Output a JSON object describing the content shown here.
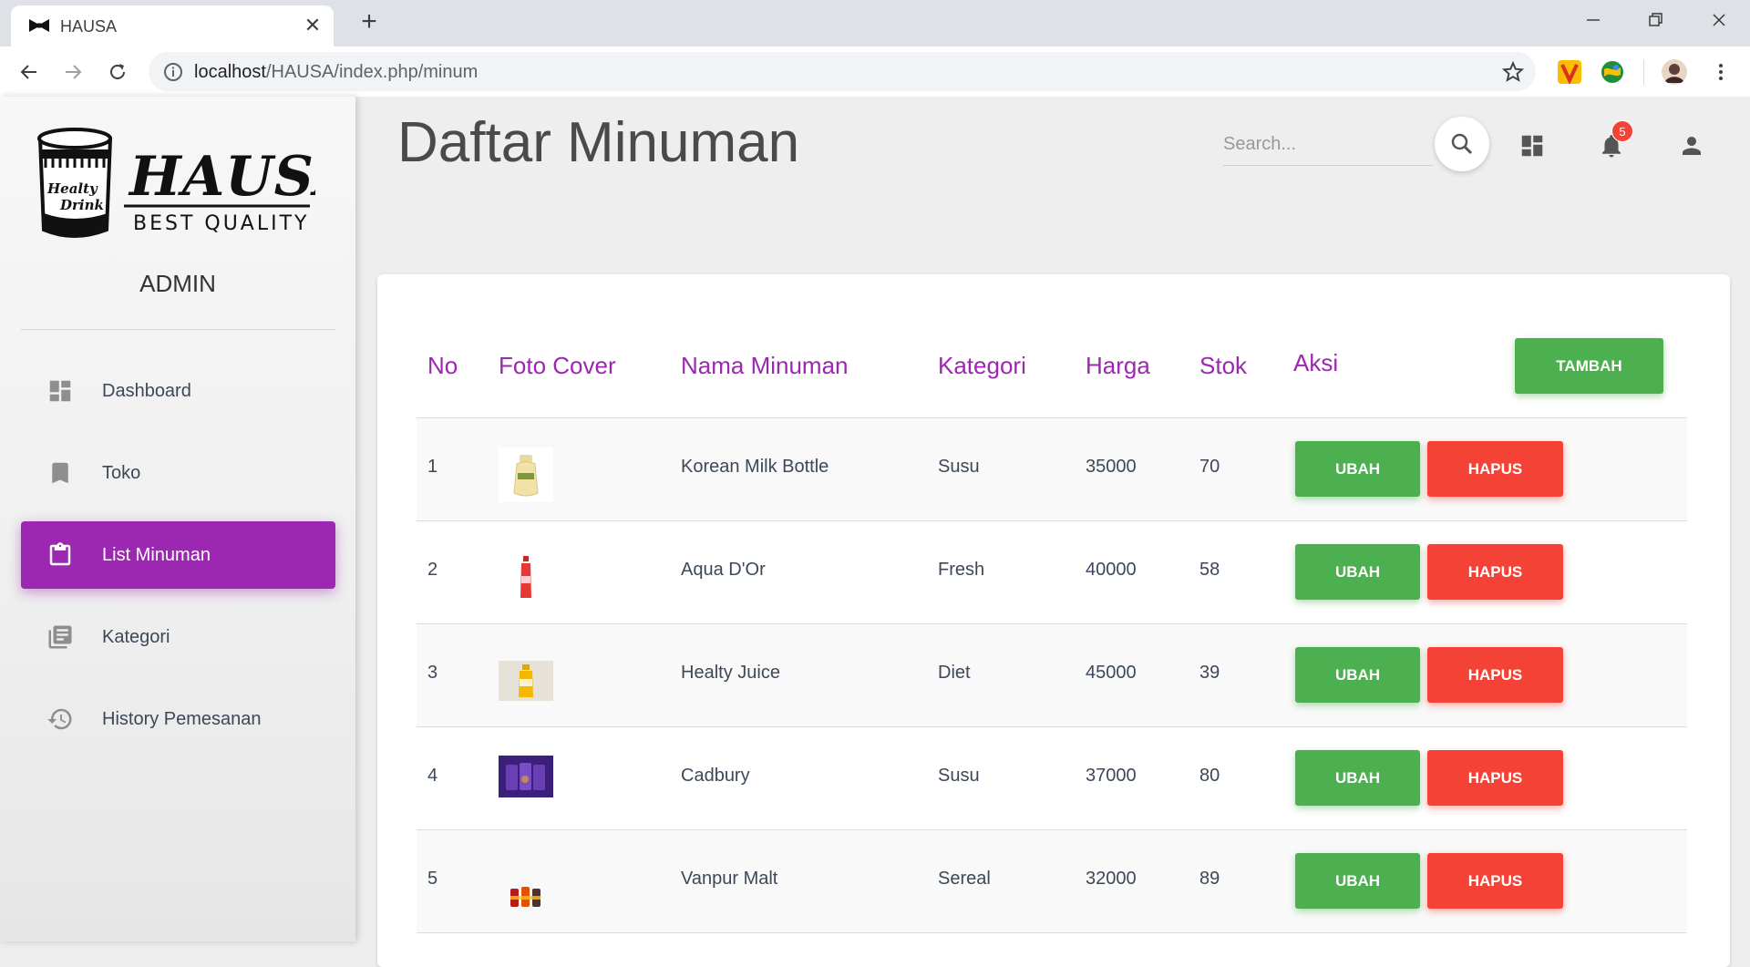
{
  "browser": {
    "tab_title": "HAUSA",
    "url_host": "localhost",
    "url_path": "/HAUSA/index.php/minum"
  },
  "sidebar": {
    "logo_text": "HAUSA",
    "logo_tagline": "BEST QUALITY",
    "logo_cup_text_1": "Healty",
    "logo_cup_text_2": "Drink",
    "role": "ADMIN",
    "items": [
      {
        "label": "Dashboard",
        "icon": "dashboard-icon"
      },
      {
        "label": "Toko",
        "icon": "bookmark-icon"
      },
      {
        "label": "List Minuman",
        "icon": "clipboard-icon",
        "active": true
      },
      {
        "label": "Kategori",
        "icon": "library-books-icon"
      },
      {
        "label": "History Pemesanan",
        "icon": "history-icon"
      }
    ]
  },
  "header": {
    "title": "Daftar Minuman",
    "search_placeholder": "Search...",
    "notification_count": "5"
  },
  "table": {
    "headers": [
      "No",
      "Foto Cover",
      "Nama Minuman",
      "Kategori",
      "Harga",
      "Stok",
      "Aksi"
    ],
    "add_button": "TAMBAH",
    "edit_label": "UBAH",
    "delete_label": "HAPUS",
    "rows": [
      {
        "no": "1",
        "nama": "Korean Milk Bottle",
        "kategori": "Susu",
        "harga": "35000",
        "stok": "70"
      },
      {
        "no": "2",
        "nama": "Aqua D'Or",
        "kategori": "Fresh",
        "harga": "40000",
        "stok": "58"
      },
      {
        "no": "3",
        "nama": "Healty Juice",
        "kategori": "Diet",
        "harga": "45000",
        "stok": "39"
      },
      {
        "no": "4",
        "nama": "Cadbury",
        "kategori": "Susu",
        "harga": "37000",
        "stok": "80"
      },
      {
        "no": "5",
        "nama": "Vanpur Malt",
        "kategori": "Sereal",
        "harga": "32000",
        "stok": "89"
      }
    ]
  },
  "colors": {
    "accent": "#9c27b0",
    "success": "#4caf50",
    "danger": "#f44336"
  }
}
